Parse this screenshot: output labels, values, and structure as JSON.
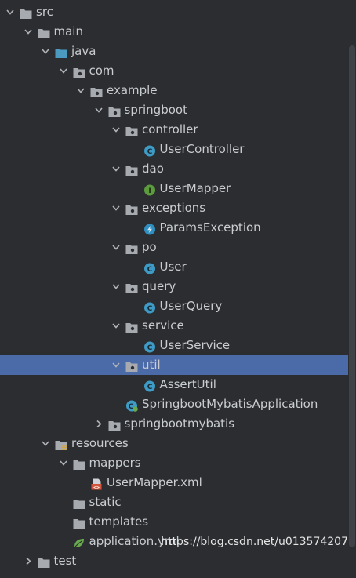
{
  "colors": {
    "background": "#2b2d30",
    "selection": "#4a6aa8",
    "folder": "#a7abb0",
    "source_folder": "#4a9ac2",
    "class_icon": "#3d9bc6",
    "interface_icon": "#5c9c3d",
    "exception_icon": "#2f8fc1",
    "xml_icon": "#d2543b",
    "spring_icon": "#6aaa4e"
  },
  "tree": [
    {
      "label": "src",
      "depth": 0,
      "expanded": true,
      "icon": "folder-icon"
    },
    {
      "label": "main",
      "depth": 1,
      "expanded": true,
      "icon": "folder-icon"
    },
    {
      "label": "java",
      "depth": 2,
      "expanded": true,
      "icon": "source-folder-icon"
    },
    {
      "label": "com",
      "depth": 3,
      "expanded": true,
      "icon": "package-icon"
    },
    {
      "label": "example",
      "depth": 4,
      "expanded": true,
      "icon": "package-icon"
    },
    {
      "label": "springboot",
      "depth": 5,
      "expanded": true,
      "icon": "package-icon"
    },
    {
      "label": "controller",
      "depth": 6,
      "expanded": true,
      "icon": "package-icon"
    },
    {
      "label": "UserController",
      "depth": 7,
      "expanded": null,
      "icon": "class-icon"
    },
    {
      "label": "dao",
      "depth": 6,
      "expanded": true,
      "icon": "package-icon"
    },
    {
      "label": "UserMapper",
      "depth": 7,
      "expanded": null,
      "icon": "interface-icon"
    },
    {
      "label": "exceptions",
      "depth": 6,
      "expanded": true,
      "icon": "package-icon"
    },
    {
      "label": "ParamsException",
      "depth": 7,
      "expanded": null,
      "icon": "exception-icon"
    },
    {
      "label": "po",
      "depth": 6,
      "expanded": true,
      "icon": "package-icon"
    },
    {
      "label": "User",
      "depth": 7,
      "expanded": null,
      "icon": "class-icon"
    },
    {
      "label": "query",
      "depth": 6,
      "expanded": true,
      "icon": "package-icon"
    },
    {
      "label": "UserQuery",
      "depth": 7,
      "expanded": null,
      "icon": "class-icon"
    },
    {
      "label": "service",
      "depth": 6,
      "expanded": true,
      "icon": "package-icon"
    },
    {
      "label": "UserService",
      "depth": 7,
      "expanded": null,
      "icon": "class-icon"
    },
    {
      "label": "util",
      "depth": 6,
      "expanded": true,
      "icon": "package-icon",
      "selected": true
    },
    {
      "label": "AssertUtil",
      "depth": 7,
      "expanded": null,
      "icon": "class-icon"
    },
    {
      "label": "SpringbootMybatisApplication",
      "depth": 6,
      "expanded": null,
      "icon": "spring-app-icon"
    },
    {
      "label": "springbootmybatis",
      "depth": 5,
      "expanded": false,
      "icon": "package-icon"
    },
    {
      "label": "resources",
      "depth": 2,
      "expanded": true,
      "icon": "resources-folder-icon"
    },
    {
      "label": "mappers",
      "depth": 3,
      "expanded": true,
      "icon": "folder-icon"
    },
    {
      "label": "UserMapper.xml",
      "depth": 4,
      "expanded": null,
      "icon": "xml-file-icon"
    },
    {
      "label": "static",
      "depth": 3,
      "expanded": null,
      "icon": "folder-icon"
    },
    {
      "label": "templates",
      "depth": 3,
      "expanded": null,
      "icon": "folder-icon"
    },
    {
      "label": "application.yml",
      "depth": 3,
      "expanded": null,
      "icon": "spring-config-icon"
    },
    {
      "label": "test",
      "depth": 1,
      "expanded": false,
      "icon": "folder-icon"
    }
  ],
  "watermark": "https://blog.csdn.net/u013574207"
}
